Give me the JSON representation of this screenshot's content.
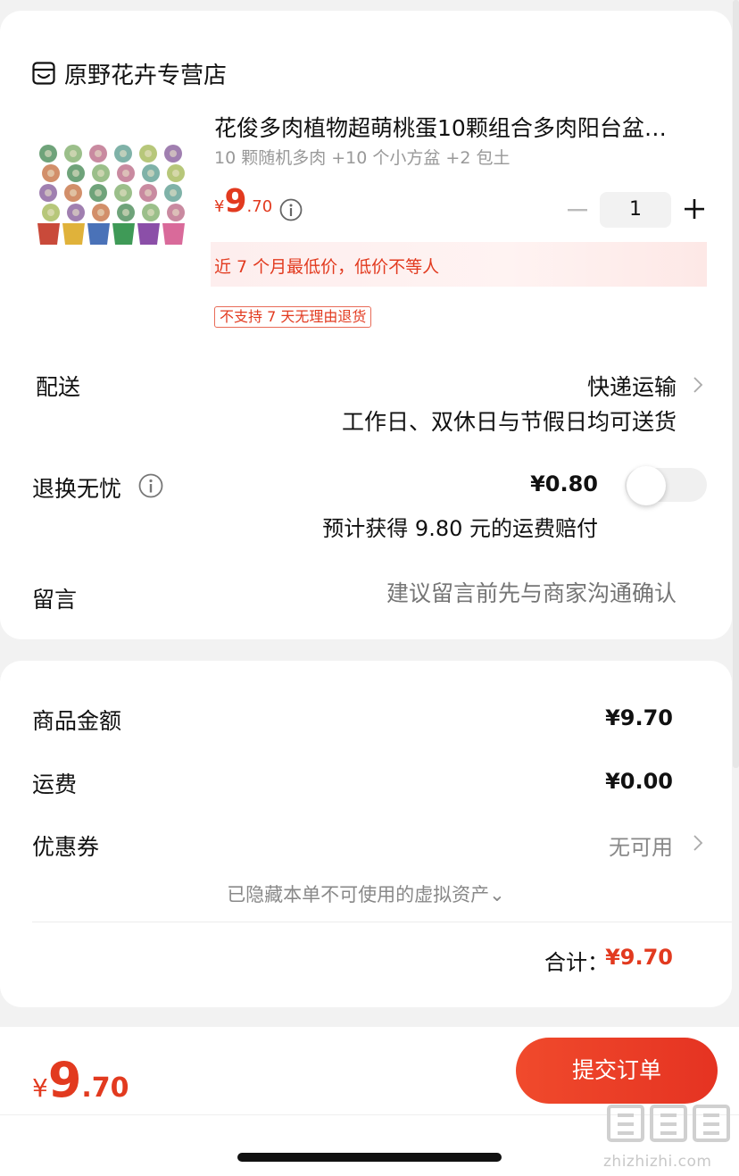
{
  "store": {
    "name": "原野花卉专营店",
    "icon": "store-icon"
  },
  "product": {
    "title": "花俊多肉植物超萌桃蛋10颗组合多肉阳台盆…",
    "spec": "10 颗随机多肉 +10 个小方盆 +2 包土",
    "price": {
      "currency": "¥",
      "integer": "9",
      "decimal": ".70"
    },
    "quantity": "1",
    "lowest_price_note": "近 7 个月最低价，低价不等人",
    "no_return_tag": "不支持 7 天无理由退货"
  },
  "delivery": {
    "label": "配送",
    "method": "快递运输",
    "note": "工作日、双休日与节假日均可送货"
  },
  "return_insurance": {
    "label": "退换无忧",
    "price": "¥0.80",
    "note": "预计获得 9.80 元的运费赔付",
    "enabled": false
  },
  "message": {
    "label": "留言",
    "placeholder": "建议留言前先与商家沟通确认"
  },
  "summary": {
    "goods_label": "商品金额",
    "goods_value": "¥9.70",
    "shipping_label": "运费",
    "shipping_value": "¥0.00",
    "coupon_label": "优惠券",
    "coupon_value": "无可用",
    "hidden_assets": "已隐藏本单不可使用的虚拟资产⌄",
    "total_label": "合计：",
    "total_value": "¥9.70"
  },
  "bottom_bar": {
    "price": {
      "currency": "¥",
      "integer": "9",
      "decimal": ".70"
    },
    "submit_label": "提交订单"
  },
  "watermark": "zhizhizhi.com",
  "colors": {
    "accent": "#e23a1f",
    "background": "#f2f2f2",
    "muted": "#999999"
  }
}
